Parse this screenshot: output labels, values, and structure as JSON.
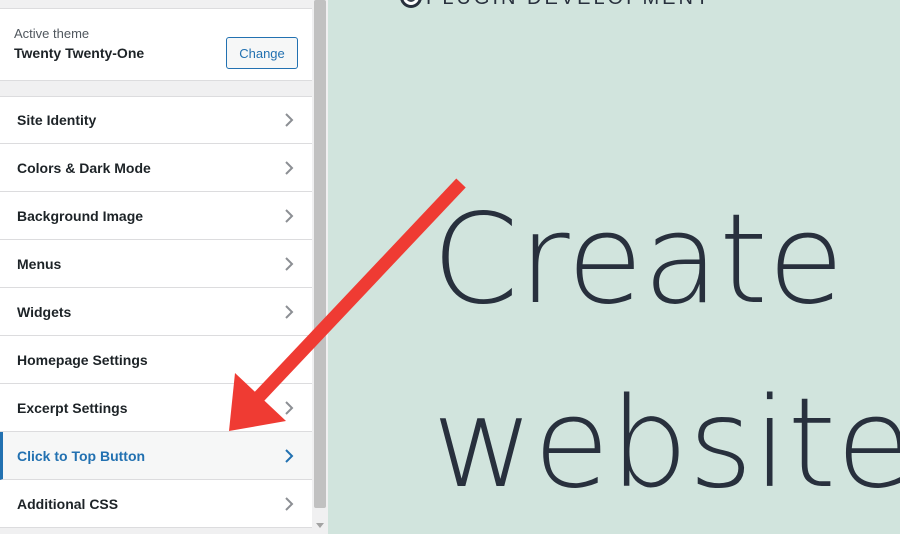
{
  "theme": {
    "label": "Active theme",
    "name": "Twenty Twenty-One",
    "change_label": "Change"
  },
  "menu": {
    "items": [
      {
        "label": "Site Identity",
        "active": false,
        "chevron": true
      },
      {
        "label": "Colors & Dark Mode",
        "active": false,
        "chevron": true
      },
      {
        "label": "Background Image",
        "active": false,
        "chevron": true
      },
      {
        "label": "Menus",
        "active": false,
        "chevron": true
      },
      {
        "label": "Widgets",
        "active": false,
        "chevron": true
      },
      {
        "label": "Homepage Settings",
        "active": false,
        "chevron": false
      },
      {
        "label": "Excerpt Settings",
        "active": false,
        "chevron": true
      },
      {
        "label": "Click to Top Button",
        "active": true,
        "chevron": true
      },
      {
        "label": "Additional CSS",
        "active": false,
        "chevron": true
      }
    ]
  },
  "preview": {
    "top_text": "PLUGIN DEVELOPMENT",
    "hero_line1": "Create",
    "hero_line2": "website"
  },
  "colors": {
    "accent": "#2271b1",
    "preview_bg": "#d1e4dd",
    "annotation_arrow": "#ef3b33"
  },
  "icons": {
    "chevron": "chevron-right-icon"
  }
}
